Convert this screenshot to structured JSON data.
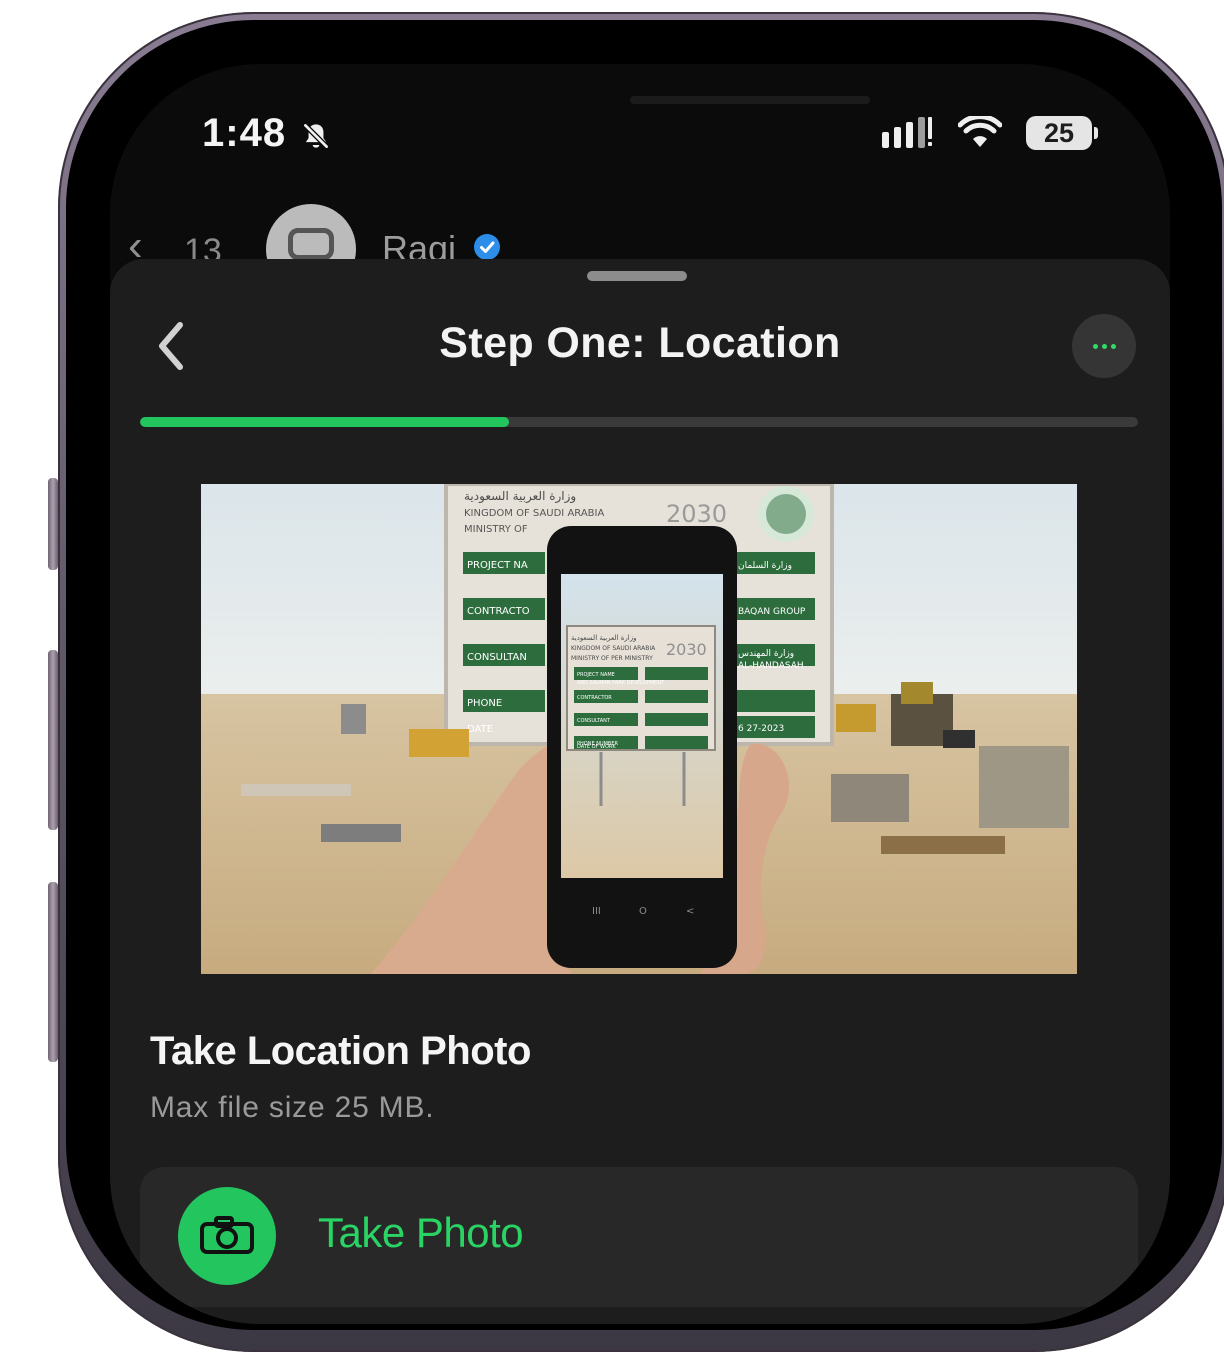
{
  "status_bar": {
    "time": "1:48",
    "mute_icon": "bell-slash-icon",
    "signal_icon": "signal-icon",
    "wifi_icon": "wifi-icon",
    "battery_icon": "battery-icon",
    "battery_level": "25"
  },
  "chat_header": {
    "back_icon": "chevron-left-icon",
    "unread_count": "13",
    "name": "Raqi",
    "verified_icon": "verified-badge-icon",
    "avatar_icon": "avatar-icon"
  },
  "sheet": {
    "title": "Step One: Location",
    "back_icon": "chevron-left-icon",
    "more_icon": "ellipsis-icon",
    "progress": 0.37
  },
  "hero_image": {
    "description": "",
    "sign_lines": [
      "وزارة العربية السعودية",
      "KINGDOM OF SAUDI ARABIA",
      "MINISTRY OF",
      "2030",
      "PROJECT NA",
      "CONTRACTO",
      "CONSULTAN",
      "PHONE",
      "DATE",
      "وزارة السلمان",
      "BAQAN GROUP",
      "وزارة المهندس",
      "AL-HANDASAH",
      "6 27-2023"
    ],
    "phone_screen_lines": [
      "وزارة العربية السعودية",
      "KINGDOM OF SAUDI ARABIA",
      "MINISTRY OF PER MINISTRY",
      "2030",
      "PROJECT NAME",
      "AND SALMAN PARK DEVELOPMENT",
      "CONTRACTOR",
      "CONSULTANT",
      "PHONE NUMBER",
      "DATE OF WORK"
    ]
  },
  "content": {
    "photo_title": "Take Location Photo",
    "photo_subtitle": "Max file size 25 MB.",
    "take_photo_label": "Take Photo",
    "camera_icon": "camera-icon"
  },
  "colors": {
    "accent_green": "#22c55e",
    "background": "#1d1d1d",
    "text_primary": "#f3f3f3",
    "text_secondary": "#9a9a9a"
  }
}
